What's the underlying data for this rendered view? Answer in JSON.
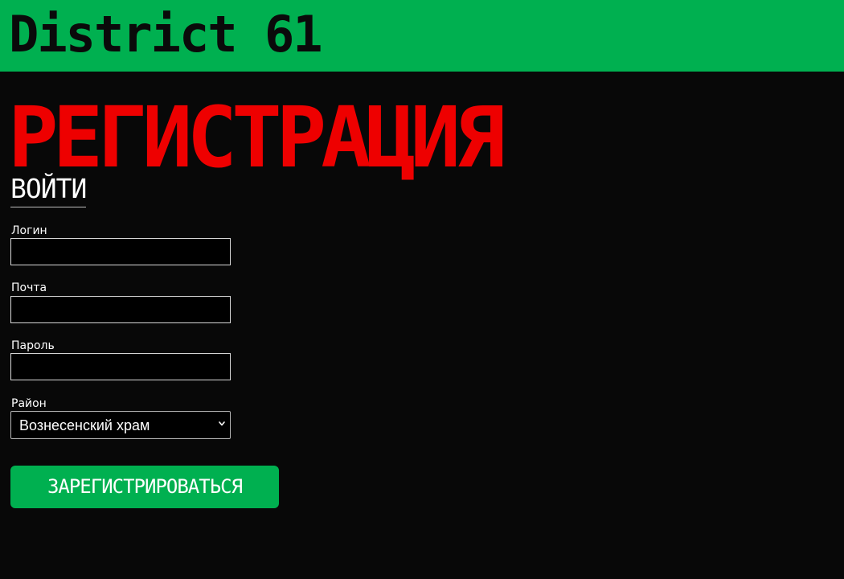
{
  "header": {
    "brand": "District 61",
    "background_color": "#00b050"
  },
  "page": {
    "title": "РЕГИСТРАЦИЯ",
    "title_color": "#ee0000",
    "background_color": "#080808",
    "login_link": "ВОЙТИ"
  },
  "form": {
    "login": {
      "label": "Логин",
      "value": ""
    },
    "email": {
      "label": "Почта",
      "value": ""
    },
    "password": {
      "label": "Пароль",
      "value": ""
    },
    "district": {
      "label": "Район",
      "selected": "Вознесенский храм",
      "icon": "chevron-down-icon"
    },
    "submit_label": "ЗАРЕГИСТРИРОВАТЬСЯ"
  }
}
